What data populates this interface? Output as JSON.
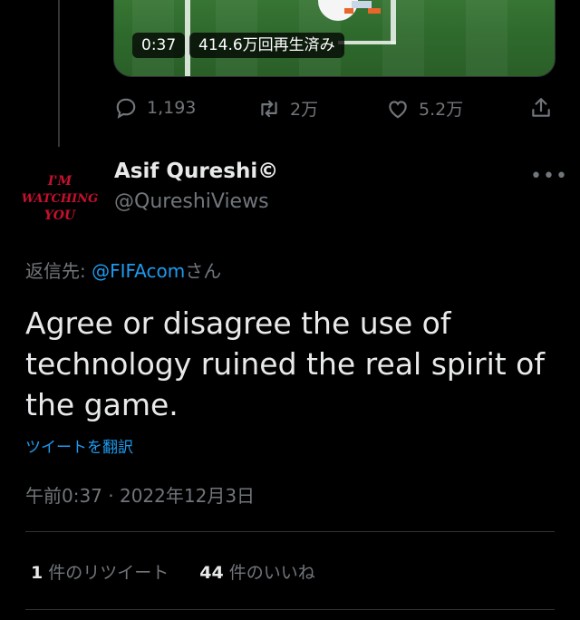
{
  "video": {
    "duration": "0:37",
    "views": "414.6万回再生済み"
  },
  "actions": {
    "reply_count": "1,193",
    "retweet_count": "2万",
    "like_count": "5.2万"
  },
  "tweet": {
    "display_name": "Asif Qureshi©",
    "handle": "@QureshiViews",
    "avatar_text": [
      "I'M",
      "WATCHING",
      "YOU"
    ],
    "reply_prefix": "返信先: ",
    "reply_mention": "@FIFAcom",
    "reply_suffix": "さん",
    "text": "Agree or disagree the use of technology ruined the real spirit of the game.",
    "translate_label": "ツイートを翻訳",
    "timestamp": "午前0:37 · 2022年12月3日",
    "more_label": "•••"
  },
  "stats": {
    "retweets_count": "1",
    "retweets_label": "件のリツイート",
    "likes_count": "44",
    "likes_label": "件のいいね"
  },
  "colors": {
    "background": "#000000",
    "text_primary": "#e7e9ea",
    "text_secondary": "#71767b",
    "accent": "#1d9bf0",
    "avatar_text": "#c8102e"
  }
}
